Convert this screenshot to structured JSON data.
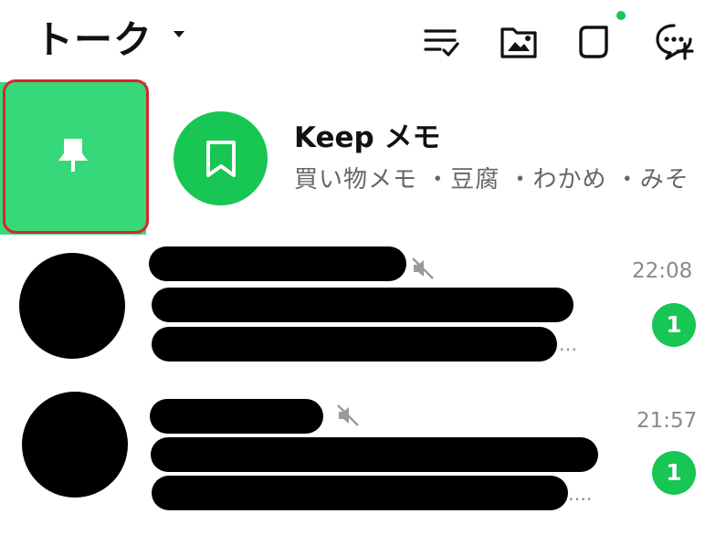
{
  "header": {
    "title": "トーク",
    "icons": [
      "list-check-icon",
      "photo-folder-icon",
      "square-icon",
      "new-chat-icon"
    ],
    "notification_dot_color": "#17c653"
  },
  "pinned": {
    "action_icon": "pin-icon",
    "background": "#36d97a"
  },
  "keep": {
    "name": "Keep メモ",
    "preview": "買い物メモ ・豆腐 ・わかめ ・みそ",
    "avatar_icon": "bookmark-icon"
  },
  "chats": [
    {
      "time": "22:08",
      "badge": "1",
      "muted": true,
      "ellipsis": "…"
    },
    {
      "time": "21:57",
      "badge": "1",
      "muted": true,
      "ellipsis": "…."
    }
  ]
}
